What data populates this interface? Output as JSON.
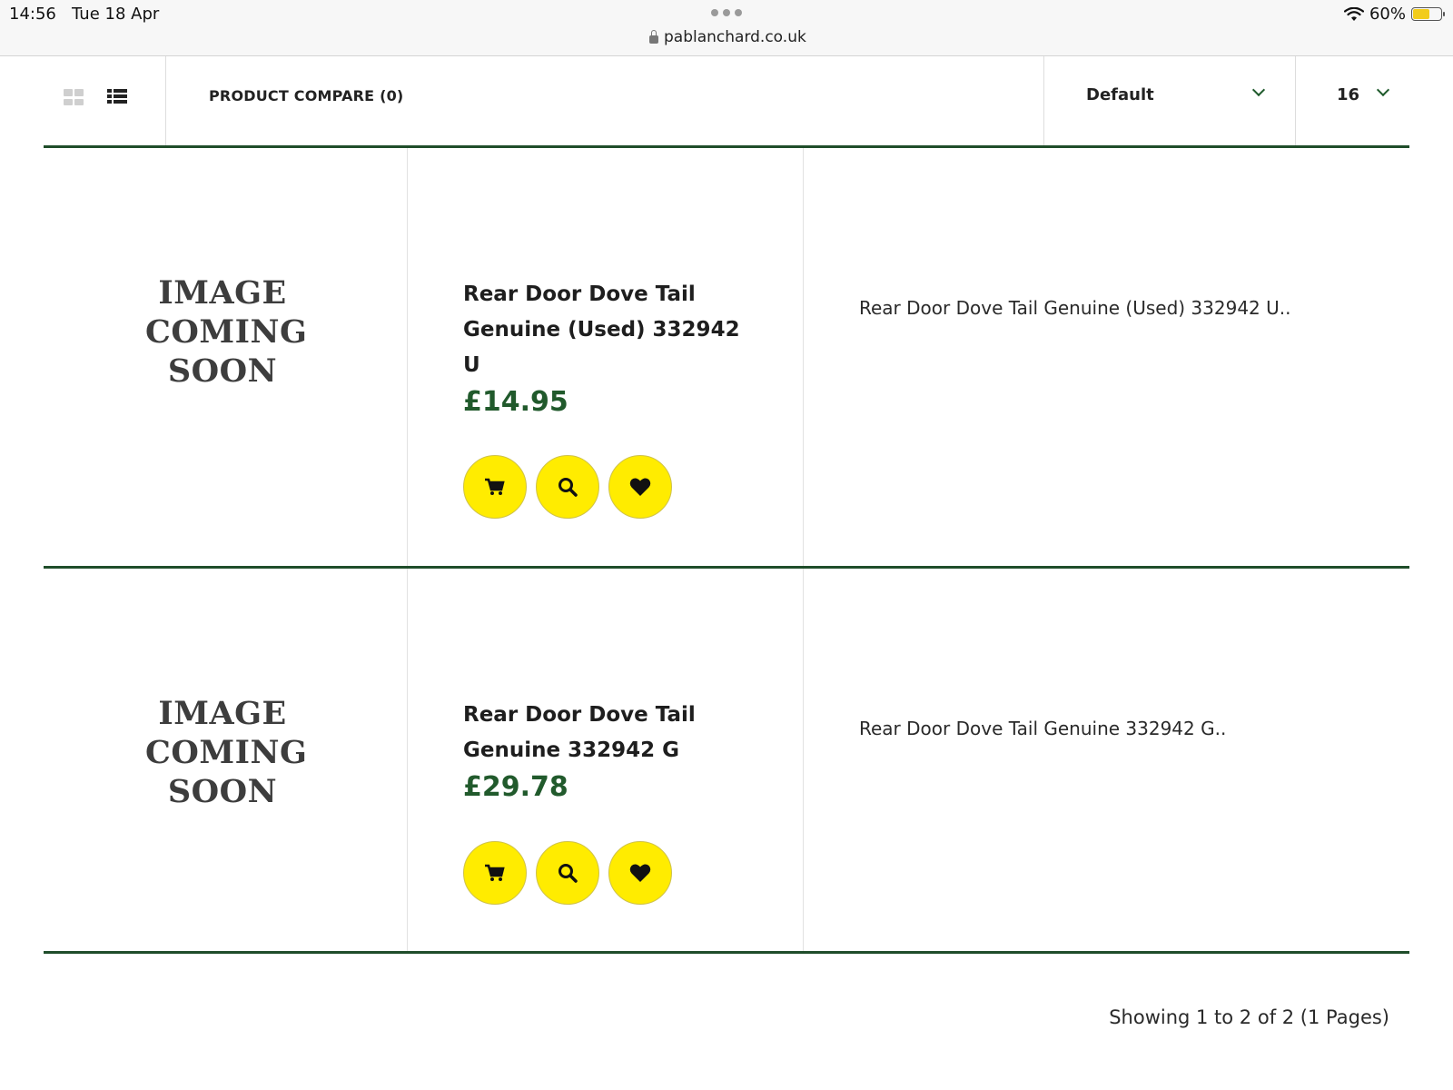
{
  "status_bar": {
    "time": "14:56",
    "date": "Tue 18 Apr",
    "url": "pablanchard.co.uk",
    "battery": "60%",
    "battery_level": 0.6
  },
  "toolbar": {
    "compare_label": "PRODUCT COMPARE (0)",
    "sort_value": "Default",
    "limit_value": "16"
  },
  "products": [
    {
      "image_text": [
        "IMAGE",
        "COMING",
        "SOON"
      ],
      "name": "Rear Door Dove Tail Genuine (Used) 332942 U",
      "price": "£14.95",
      "description": "Rear Door Dove Tail Genuine (Used) 332942 U.."
    },
    {
      "image_text": [
        "IMAGE",
        "COMING",
        "SOON"
      ],
      "name": "Rear Door Dove Tail Genuine 332942 G",
      "price": "£29.78",
      "description": "Rear Door Dove Tail Genuine 332942 G.."
    }
  ],
  "pagination": {
    "summary": "Showing 1 to 2 of 2 (1 Pages)"
  },
  "colors": {
    "accent_green": "#215a2c",
    "button_yellow": "#ffec00"
  },
  "icons": {
    "cart": "cart-icon",
    "quick_view": "search-icon",
    "wishlist": "heart-icon"
  }
}
